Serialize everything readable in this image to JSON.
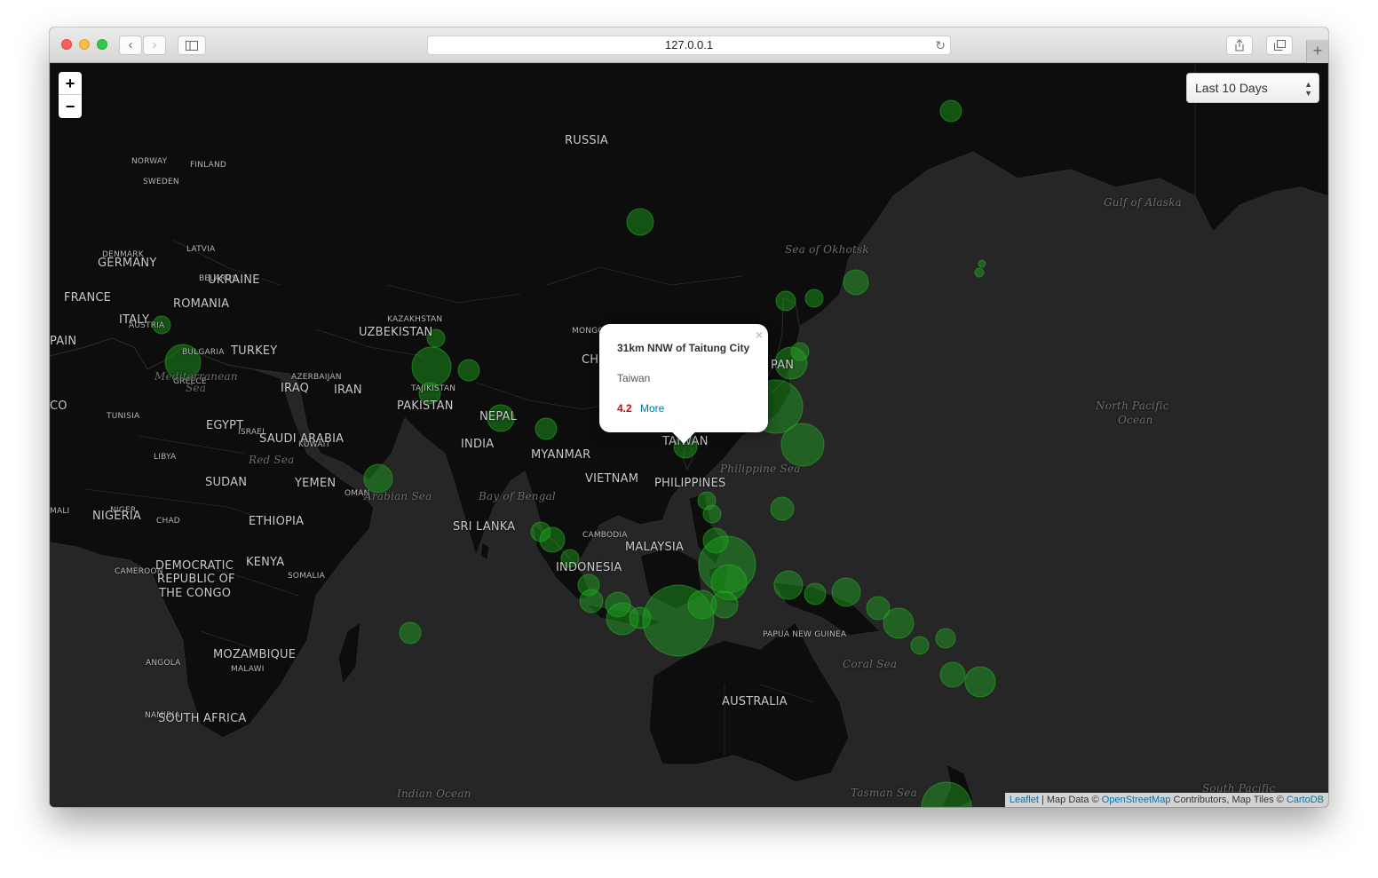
{
  "browser": {
    "url": "127.0.0.1"
  },
  "map": {
    "zoom_in": "+",
    "zoom_out": "−",
    "time_filter": {
      "selected": "Last 10 Days"
    },
    "labels": {
      "countries": [
        "RUSSIA",
        "NORWAY",
        "FINLAND",
        "SWEDEN",
        "DENMARK",
        "LATVIA",
        "BELARUS",
        "GERMANY",
        "UKRAINE",
        "FRANCE",
        "AUSTRIA",
        "ROMANIA",
        "ITALY",
        "BULGARIA",
        "PAIN",
        "GREECE",
        "TURKEY",
        "AZERBAIJAN",
        "UZBEKISTAN",
        "KAZAKHSTAN",
        "MONGOLIA",
        "TAJIKISTAN",
        "TUNISIA",
        "ISRAEL",
        "IRAQ",
        "IRAN",
        "KUWAIT",
        "PAKISTAN",
        "NEPAL",
        "CH",
        "PAN",
        "LIBYA",
        "EGYPT",
        "SAUDI ARABIA",
        "INDIA",
        "MYANMAR",
        "TAIWAN",
        "CO",
        "OMAN",
        "MALI",
        "NIGER",
        "CHAD",
        "SUDAN",
        "YEMEN",
        "VIETNAM",
        "PHILIPPINES",
        "CAMBODIA",
        "NIGERIA",
        "ETHIOPIA",
        "SRI LANKA",
        "CAMEROON",
        "SOMALIA",
        "MALAYSIA",
        "DEMOCRATIC",
        "REPUBLIC OF",
        "THE CONGO",
        "KENYA",
        "INDONESIA",
        "PAPUA NEW GUINEA",
        "ANGOLA",
        "MALAWI",
        "MOZAMBIQUE",
        "NAMIBIA",
        "AUSTRALIA",
        "SOUTH AFRICA"
      ],
      "seas": [
        "Gulf of Alaska",
        "Sea of Okhotsk",
        "Mediterranean",
        "Sea",
        "Red Sea",
        "Arabian Sea",
        "Bay of Bengal",
        "Philippine Sea",
        "North Pacific",
        "Ocean",
        "Coral Sea",
        "Indian Ocean",
        "Tasman Sea",
        "South Pacific"
      ]
    },
    "popup": {
      "title": "31km NNW of Taitung City",
      "country": "Taiwan",
      "magnitude": "4.2",
      "link": "More",
      "close": "×"
    },
    "attribution": {
      "leaflet": "Leaflet",
      "sep1": " | Map Data © ",
      "osm": "OpenStreetMap",
      "mid": " Contributors, Map Tiles © ",
      "cartodb": "CartoDB"
    },
    "colors": {
      "marker": "#1ea81e",
      "land": "#0d0d0d",
      "water": "#262627"
    }
  }
}
